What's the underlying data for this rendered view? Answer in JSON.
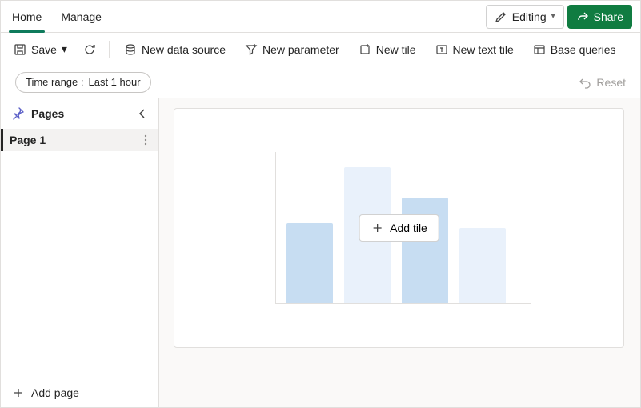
{
  "tabs": {
    "home": "Home",
    "manage": "Manage"
  },
  "editing_label": "Editing",
  "share_label": "Share",
  "toolbar": {
    "save": "Save",
    "new_data_source": "New data source",
    "new_parameter": "New parameter",
    "new_tile": "New tile",
    "new_text_tile": "New text tile",
    "base_queries": "Base queries"
  },
  "param": {
    "time_label": "Time range :",
    "time_value": "Last 1 hour"
  },
  "reset_label": "Reset",
  "sidebar": {
    "title": "Pages",
    "items": [
      {
        "label": "Page 1"
      }
    ],
    "add_page": "Add page"
  },
  "canvas": {
    "add_tile": "Add tile"
  }
}
